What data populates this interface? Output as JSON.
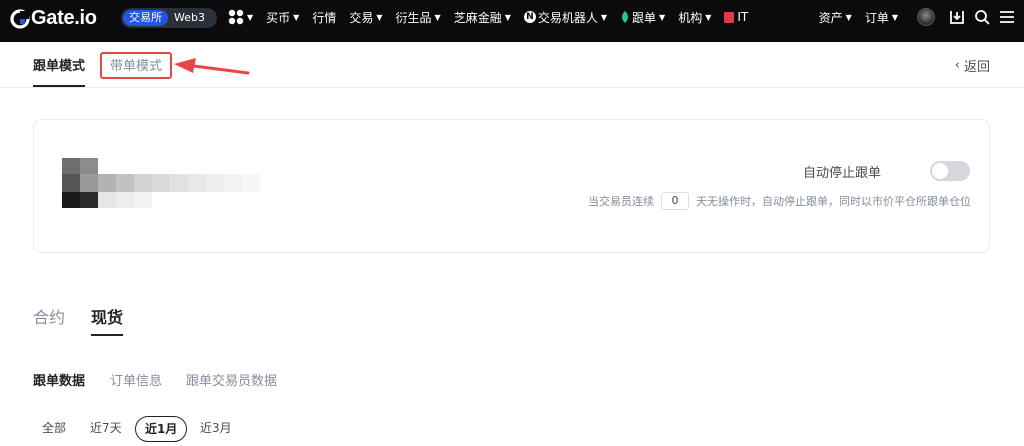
{
  "nav": {
    "logo_text": "Gate.io",
    "mode_exchange": "交易所",
    "mode_web3": "Web3",
    "items": [
      {
        "label": "买币"
      },
      {
        "label": "行情"
      },
      {
        "label": "交易"
      },
      {
        "label": "衍生品"
      },
      {
        "label": "芝麻金融"
      },
      {
        "label": "交易机器人"
      },
      {
        "label": "跟单"
      },
      {
        "label": "机构"
      },
      {
        "label": "IT"
      }
    ],
    "right_assets": "资产",
    "right_orders": "订单"
  },
  "subtabs": {
    "follow_mode": "跟单模式",
    "lead_mode": "带单模式",
    "back": "返回"
  },
  "card": {
    "auto_stop_label": "自动停止跟单",
    "auto_stop_enabled": false,
    "desc_prefix": "当交易员连续",
    "days_value": "0",
    "desc_suffix": "天无操作时，自动停止跟单，同时以市价平仓所跟单仓位"
  },
  "type_tabs": [
    {
      "label": "合约",
      "active": false
    },
    {
      "label": "现货",
      "active": true
    }
  ],
  "data_tabs": [
    {
      "label": "跟单数据",
      "active": true
    },
    {
      "label": "订单信息",
      "active": false
    },
    {
      "label": "跟单交易员数据",
      "active": false
    }
  ],
  "periods": [
    {
      "label": "全部",
      "active": false
    },
    {
      "label": "近7天",
      "active": false
    },
    {
      "label": "近1月",
      "active": true
    },
    {
      "label": "近3月",
      "active": false
    }
  ],
  "colors": {
    "nav_bg": "#0b0b0d",
    "brand_blue": "#2354e6",
    "annotation_red": "#e84545",
    "leaf_green": "#27c88a"
  }
}
